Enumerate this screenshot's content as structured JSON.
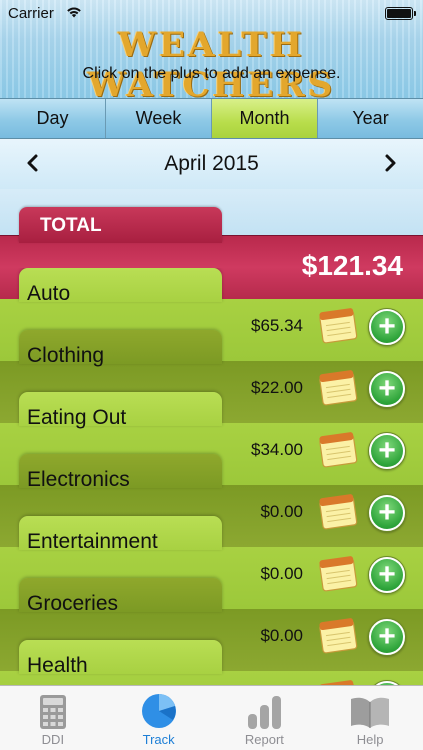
{
  "status_bar": {
    "carrier": "Carrier"
  },
  "header": {
    "title": "WEALTH WATCHERS",
    "subtitle": "Click on the plus to add an expense."
  },
  "period_tabs": [
    {
      "label": "Day",
      "active": false
    },
    {
      "label": "Week",
      "active": false
    },
    {
      "label": "Month",
      "active": true
    },
    {
      "label": "Year",
      "active": false
    }
  ],
  "month_nav": {
    "label": "April 2015",
    "prev_icon": "chevron-left-icon",
    "next_icon": "chevron-right-icon"
  },
  "total": {
    "label": "TOTAL",
    "amount": "$121.34"
  },
  "categories": [
    {
      "label": "Auto",
      "amount": "$65.34"
    },
    {
      "label": "Clothing",
      "amount": "$22.00"
    },
    {
      "label": "Eating Out",
      "amount": "$34.00"
    },
    {
      "label": "Electronics",
      "amount": "$0.00"
    },
    {
      "label": "Entertainment",
      "amount": "$0.00"
    },
    {
      "label": "Groceries",
      "amount": "$0.00"
    },
    {
      "label": "Health",
      "amount": ""
    }
  ],
  "tabbar": [
    {
      "label": "DDI",
      "icon": "calculator-icon",
      "active": false
    },
    {
      "label": "Track",
      "icon": "pie-chart-icon",
      "active": true
    },
    {
      "label": "Report",
      "icon": "bar-chart-icon",
      "active": false
    },
    {
      "label": "Help",
      "icon": "book-icon",
      "active": false
    }
  ],
  "colors": {
    "accent_blue": "#1e7fd6",
    "total_red": "#b9294c",
    "category_green_light": "#a8d142",
    "category_green_dark": "#7c9a24",
    "active_tab_green": "#b8dd4b",
    "logo_gold": "#e3a72d"
  }
}
